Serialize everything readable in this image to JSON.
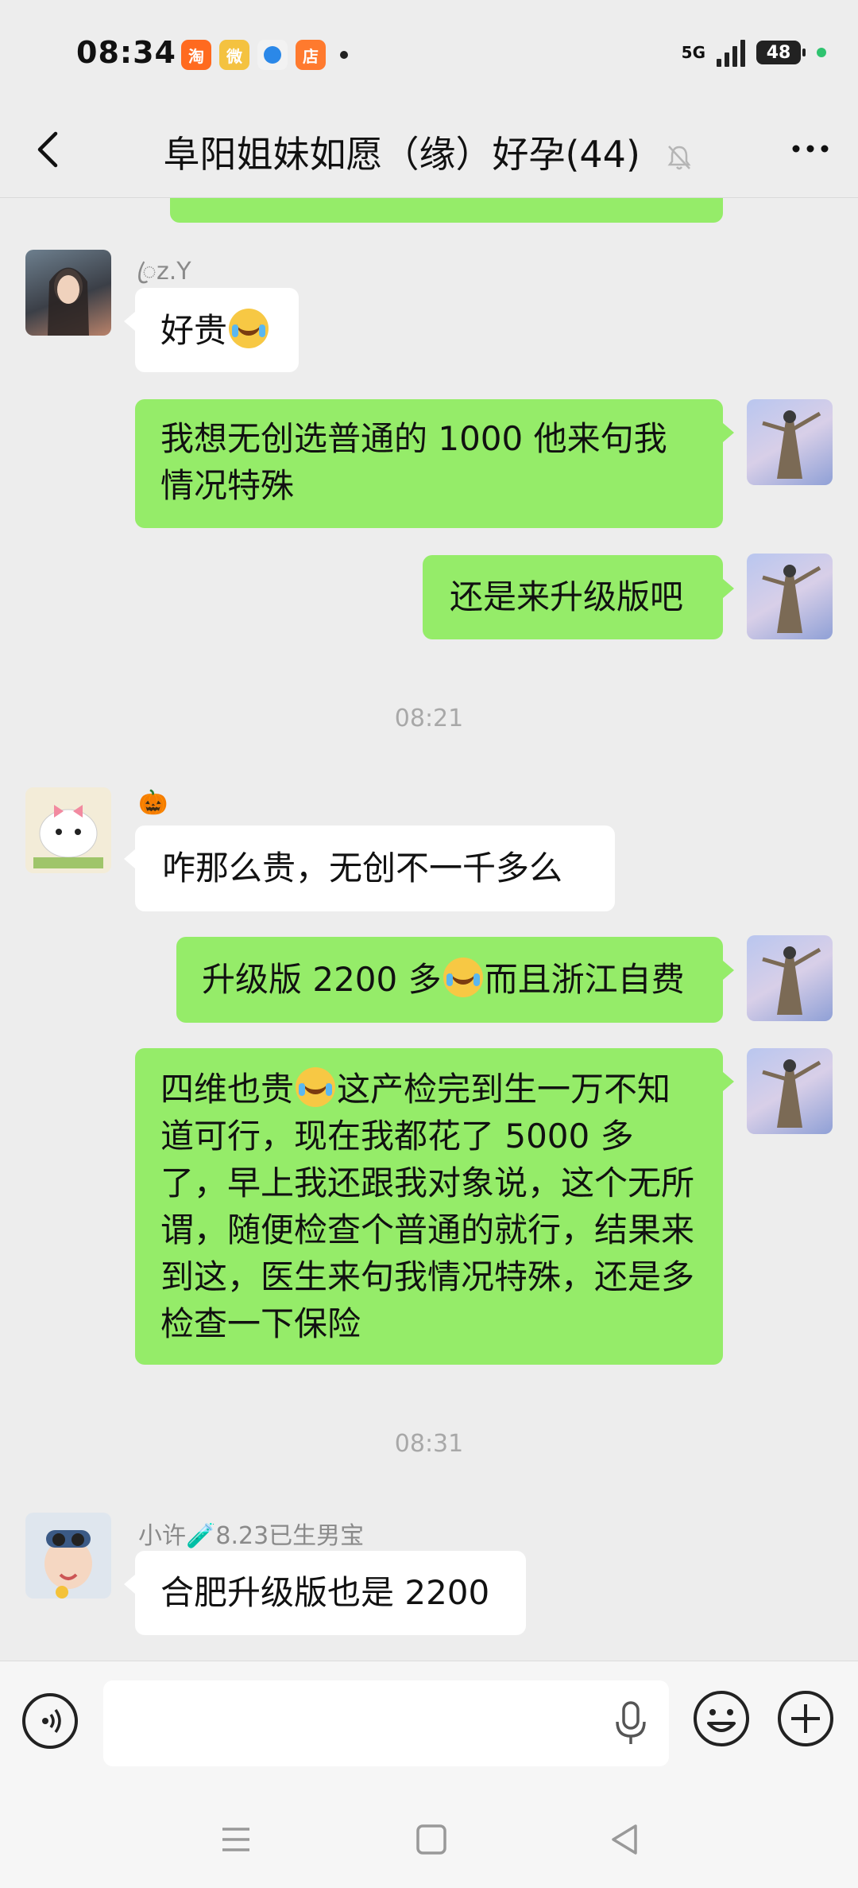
{
  "status_bar": {
    "time": "08:34",
    "network": "5G",
    "battery": "48",
    "app_icons": [
      "taobao-icon",
      "weibo-icon",
      "browser-icon",
      "store-icon"
    ]
  },
  "header": {
    "title": "阜阳姐妹如愿（缘）好孕(44)",
    "muted": true
  },
  "messages": {
    "m0": {
      "text": ""
    },
    "m1": {
      "sender": "ꦿz.Y",
      "text": "好贵"
    },
    "m2": {
      "text": "我想无创选普通的 1000 他来句我情况特殊"
    },
    "m3": {
      "text": "还是来升级版吧"
    },
    "t1": "08:21",
    "m4": {
      "sender": "🎃",
      "text": "咋那么贵，无创不一千多么"
    },
    "m5": {
      "text_a": "升级版 2200 多",
      "text_b": "而且浙江自费"
    },
    "m6": {
      "text_a": "四维也贵",
      "text_b": "这产检完到生一万不知道可行，现在我都花了 5000 多了，早上我还跟我对象说，这个无所谓，随便检查个普通的就行，结果来到这，医生来句我情况特殊，还是多检查一下保险"
    },
    "t2": "08:31",
    "m7": {
      "sender": "小许🧪8.23已生男宝",
      "text": "合肥升级版也是 2200"
    }
  },
  "input": {
    "placeholder": ""
  },
  "colors": {
    "background": "#ededed",
    "outgoing_bubble": "#95ec69",
    "incoming_bubble": "#ffffff",
    "meta_text": "#a8a8a8"
  }
}
